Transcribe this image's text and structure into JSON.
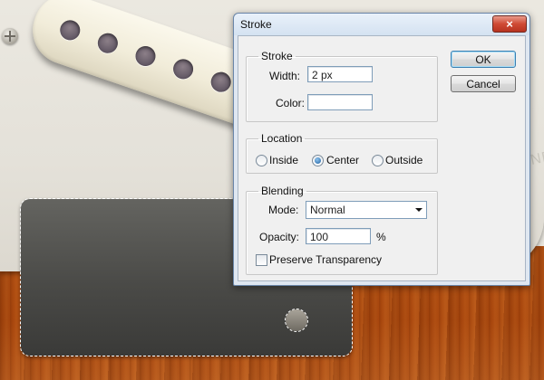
{
  "canvas": {
    "knob_text": "ONE",
    "colors": {
      "wood": "#a8460d",
      "pickguard": "#e7e4dc",
      "plate": "#4a4a47",
      "pickup": "#f1ecd9"
    }
  },
  "dialog": {
    "title": "Stroke",
    "close_icon": "×",
    "buttons": {
      "ok": "OK",
      "cancel": "Cancel"
    },
    "stroke_group": {
      "label": "Stroke",
      "width_label": "Width:",
      "width_value": "2 px",
      "color_label": "Color:",
      "color_value": "#ffffff"
    },
    "location_group": {
      "label": "Location",
      "options": [
        "Inside",
        "Center",
        "Outside"
      ],
      "selected": "Center"
    },
    "blending_group": {
      "label": "Blending",
      "mode_label": "Mode:",
      "mode_value": "Normal",
      "opacity_label": "Opacity:",
      "opacity_value": "100",
      "opacity_unit": "%",
      "preserve_label": "Preserve Transparency",
      "preserve_checked": false
    }
  }
}
